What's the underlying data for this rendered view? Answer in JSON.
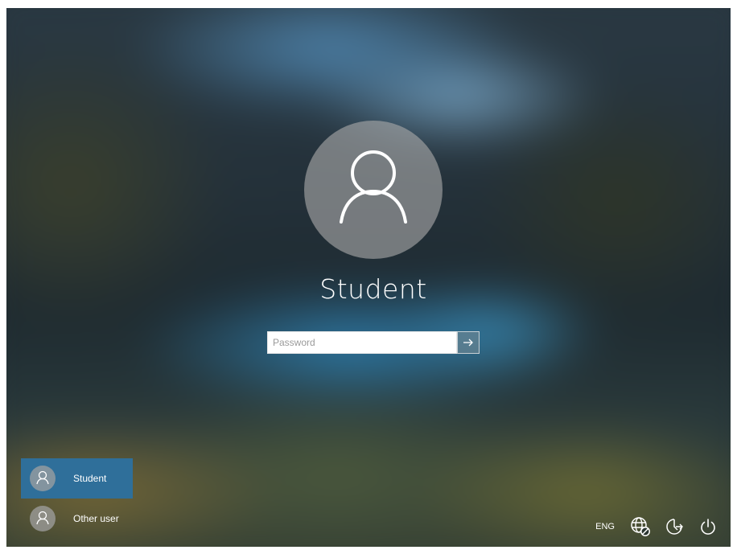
{
  "lock_screen": {
    "username": "Student"
  },
  "password_field": {
    "placeholder": "Password",
    "value": "",
    "submit_icon": "arrow-right-icon"
  },
  "user_switcher": {
    "users": [
      {
        "name": "Student",
        "icon": "user-icon",
        "selected": true
      },
      {
        "name": "Other user",
        "icon": "user-icon",
        "selected": false
      }
    ]
  },
  "system_tray": {
    "language": "ENG",
    "network_icon": "network-icon",
    "ease_of_access_icon": "ease-of-access-icon",
    "power_icon": "power-icon"
  },
  "colors": {
    "selected_user_bg": "#2f6f9a",
    "avatar_circle": "#aaaaaa",
    "text": "#ffffff"
  }
}
